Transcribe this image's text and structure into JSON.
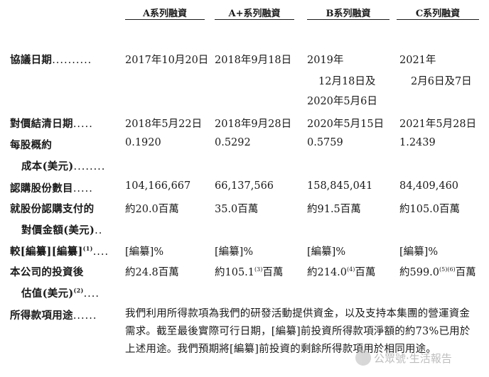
{
  "headers": [
    "A系列融資",
    "A+系列融資",
    "B系列融資",
    "C系列融資"
  ],
  "rows": {
    "agreement": {
      "label": "協議日期",
      "dots": "..........",
      "a": "2017年10月20日",
      "aplus": "2018年9月18日",
      "b": [
        "2019年",
        "12月18日及",
        "2020年5月6日"
      ],
      "c": [
        "2021年",
        "2月6日及7日"
      ]
    },
    "settlement": {
      "label": "對價結清日期",
      "dots": ".....",
      "a": "2018年5月22日",
      "aplus": "2018年9月28日",
      "b": "2020年5月15日",
      "c": "2021年5月28日"
    },
    "cost": {
      "label1": "每股概約",
      "label2": "成本(美元)",
      "dots2": "........",
      "a": "0.1920",
      "aplus": "0.5292",
      "b": "0.5759",
      "c": "1.2439"
    },
    "shares": {
      "label": "認購股份數目",
      "dots": ".....",
      "a": "104,166,667",
      "aplus": "66,137,566",
      "b": "158,845,041",
      "c": "84,409,460"
    },
    "consideration": {
      "label1": "就股份認購支付的",
      "label2": "對價金額(美元)",
      "dots2": "..",
      "a": "約20.0百萬",
      "aplus": "35.0百萬",
      "b": "約91.5百萬",
      "c": "約105.0百萬"
    },
    "discount": {
      "label": "較[編纂][編纂]",
      "sup": "(1)",
      "dots": "....",
      "a": "[編纂]%",
      "aplus": "[編纂]%",
      "b": "[編纂]%",
      "c": "[編纂]%"
    },
    "valuation": {
      "label1": "本公司的投資後",
      "label2": "估值(美元)",
      "sup2": "(2)",
      "dots2": "....",
      "a": "約24.8百萬",
      "aplus_pre": "約105.1",
      "aplus_sup": "(3)",
      "aplus_post": "百萬",
      "b_pre": "約214.0",
      "b_sup": "(4)",
      "b_post": "百萬",
      "c_pre": "約599.0",
      "c_sup": "(5)(6)",
      "c_post": "百萬"
    },
    "use": {
      "label": "所得款項用途",
      "dots": "......",
      "lines": [
        "我們利用所得款項為我們的研發活動提供資金，以及支持本集團的營運資金",
        "需求。截至最後實際可行日期，[編纂]前投資所得款項淨額的約73%已用於",
        "上述用途。我們預期將[編纂]前投資的剩餘所得款項用於相同用途。"
      ]
    }
  },
  "watermark": "公眾號·生活報告"
}
